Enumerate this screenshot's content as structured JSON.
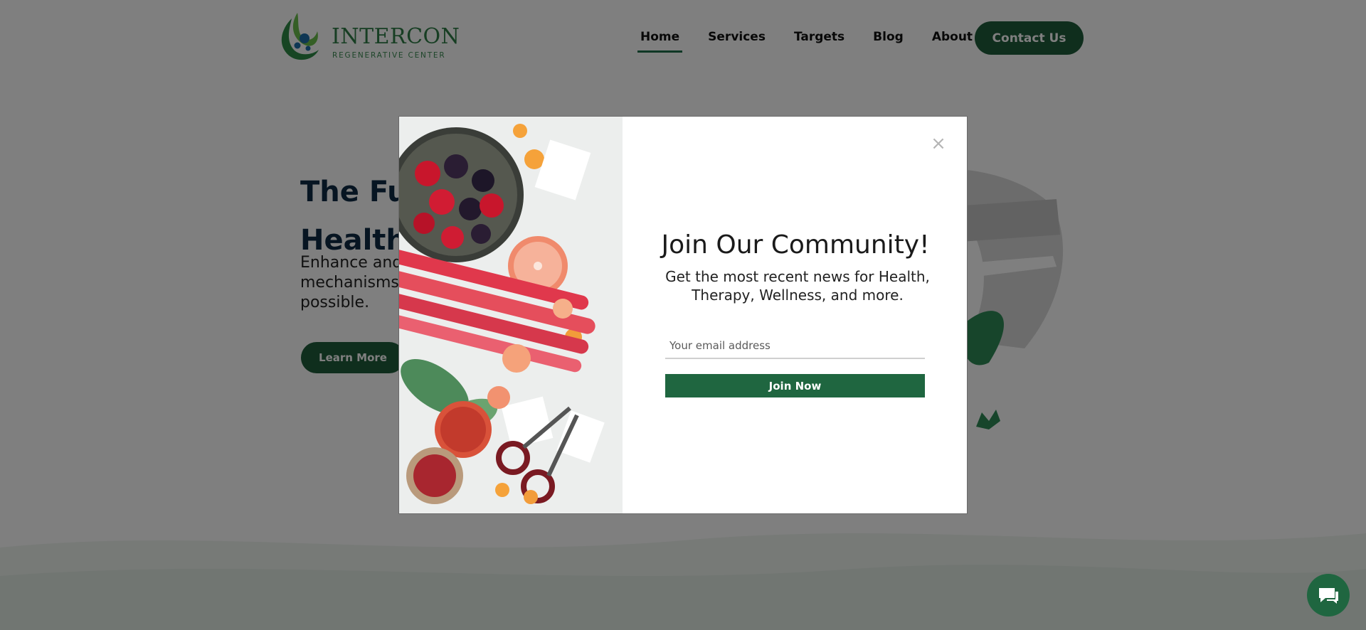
{
  "brand": {
    "name": "INTERCON",
    "tagline": "REGENERATIVE CENTER"
  },
  "nav": {
    "items": [
      {
        "label": "Home",
        "active": true
      },
      {
        "label": "Services",
        "active": false
      },
      {
        "label": "Targets",
        "active": false
      },
      {
        "label": "Blog",
        "active": false
      },
      {
        "label": "About Us",
        "active": false
      }
    ],
    "contact_label": "Contact Us"
  },
  "hero": {
    "title": "The Fut",
    "title_line2": "Health",
    "text_line1": "Enhance and",
    "text_line2": "mechanisms",
    "text_line3": "possible.",
    "button_label": "Learn More"
  },
  "modal": {
    "title": "Join Our Community!",
    "subtitle": "Get the most recent news for Health, Therapy, Wellness, and more.",
    "email_placeholder": "Your email address",
    "email_value": "",
    "button_label": "Join Now",
    "close_label": "×"
  },
  "colors": {
    "brand_green": "#1f5c3a",
    "button_green": "#1f6640",
    "heading_navy": "#0f2a44",
    "overlay": "rgba(0,0,0,0.5)"
  },
  "icons": {
    "close": "close-icon",
    "chat": "chat-icon",
    "logo": "logo-leaf-icon"
  }
}
